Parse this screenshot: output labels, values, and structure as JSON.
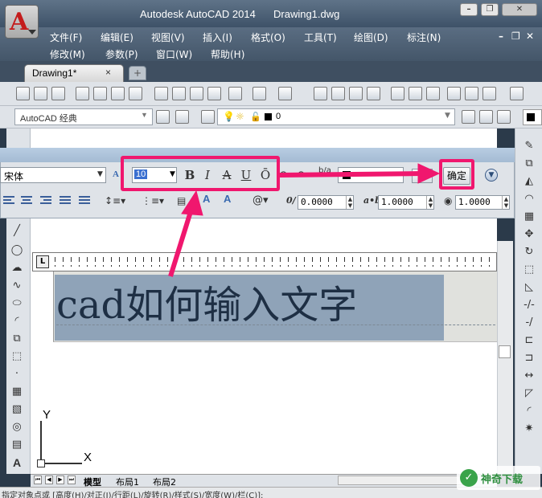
{
  "app": {
    "product": "Autodesk AutoCAD 2014",
    "document": "Drawing1.dwg",
    "logo_letter": "A"
  },
  "menubar": {
    "row1": [
      "文件(F)",
      "编辑(E)",
      "视图(V)",
      "插入(I)",
      "格式(O)",
      "工具(T)",
      "绘图(D)",
      "标注(N)"
    ],
    "row2": [
      "修改(M)",
      "参数(P)",
      "窗口(W)",
      "帮助(H)"
    ]
  },
  "tabs": {
    "active": "Drawing1*",
    "close_glyph": "×"
  },
  "workspace": {
    "value": "AutoCAD 经典"
  },
  "layer": {
    "value": "0"
  },
  "text_formatting": {
    "font": "宋体",
    "height": "10",
    "bold": "B",
    "italic": "I",
    "strikethrough": "A",
    "underline": "U",
    "overline": "Ō",
    "confirm_label": "确定",
    "oblique_value": "0.0000",
    "tracking_value": "1.0000",
    "width_value": "1.0000"
  },
  "editor": {
    "text": "cad如何输入文字"
  },
  "ruler": {
    "marker": "L"
  },
  "ucs": {
    "x": "X",
    "y": "Y"
  },
  "layout_tabs": [
    "模型",
    "布局1",
    "布局2"
  ],
  "command_line": "指定对象点或 [高度(H)/对正(J)/行距(L)/旋转(R)/样式(S)/宽度(W)/栏(C)]:",
  "watermark": {
    "text": "神奇下载"
  },
  "colors": {
    "highlight": "#f0176e",
    "selection": "#8fa3b8",
    "title_bar": "#4e6278"
  }
}
